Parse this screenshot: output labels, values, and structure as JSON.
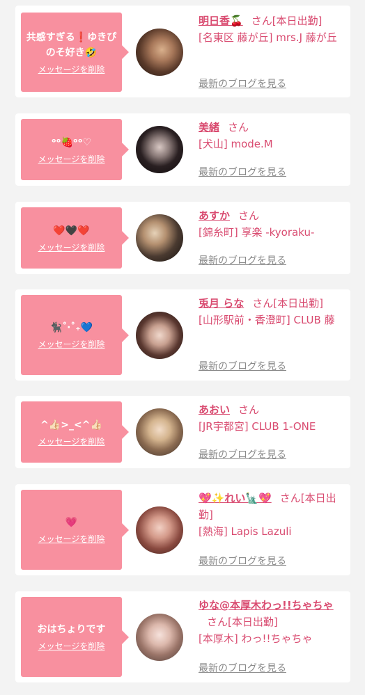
{
  "delete_label": "メッセージを削除",
  "blog_label": "最新のブログを見る",
  "san": "さん",
  "cards": [
    {
      "message": "共感すぎる❗️ゆきぴのそ好き🤣",
      "name": "明日香🍒",
      "status": "[本日出勤]",
      "shop": "[名東区 藤が丘] mrs.J 藤が丘"
    },
    {
      "message": "ᵒᵒ🍓ᵒᵒ♡",
      "name": "美緒",
      "status": "",
      "shop": "[犬山] mode.M"
    },
    {
      "message": "❤️🖤❤️",
      "name": "あすか",
      "status": "",
      "shop": "[錦糸町] 享楽 -kyoraku-"
    },
    {
      "message": "🐈‍⬛˚‧˚₊💙",
      "name": "兎月 らな",
      "status": "[本日出勤]",
      "shop": "[山形駅前・香澄町] CLUB 藤"
    },
    {
      "message": "^👍🏻>_<^👍🏻",
      "name": "あおい",
      "status": "",
      "shop": "[JR宇都宮] CLUB 1-ONE"
    },
    {
      "message": "💗",
      "name": "💖✨れい🗽💖",
      "status": "[本日出勤]",
      "shop": "[熱海] Lapis Lazuli"
    },
    {
      "message": "おはちょりです",
      "name": "ゆな@本厚木わっ!!ちゃちゃ",
      "status": "[本日出勤]",
      "shop": "[本厚木] わっ!!ちゃちゃ"
    }
  ]
}
